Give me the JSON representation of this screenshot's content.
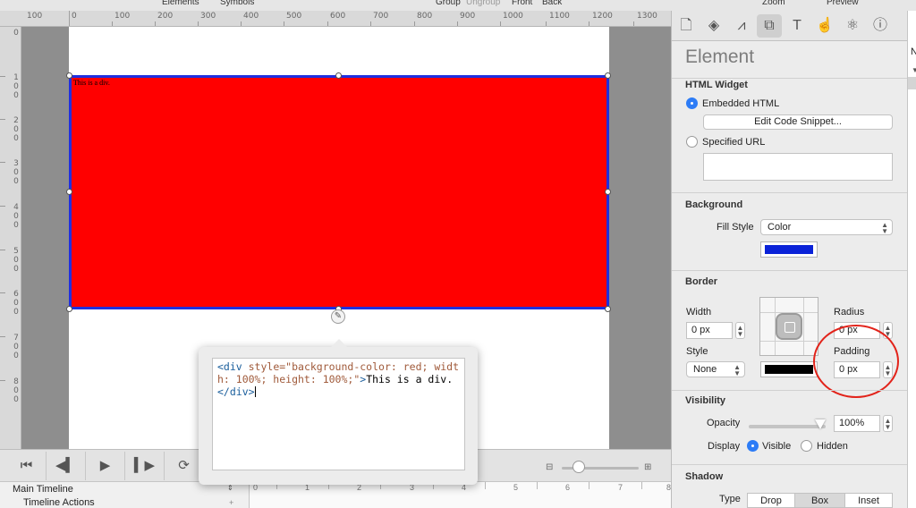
{
  "menu": {
    "elements": "Elements",
    "symbols": "Symbols",
    "group": "Group",
    "ungroup": "Ungroup",
    "front": "Front",
    "back": "Back",
    "zoom": "Zoom",
    "preview": "Preview"
  },
  "ruler": {
    "top_labels": [
      "100",
      "0",
      "100",
      "200",
      "300",
      "400",
      "500",
      "600",
      "700",
      "800",
      "900",
      "1000",
      "1100",
      "1200",
      "1300"
    ],
    "left_labels": [
      "0",
      "1 0 0",
      "2 0 0",
      "3 0 0",
      "4 0 0",
      "5 0 0",
      "6 0 0",
      "7 0 0",
      "8 0 0"
    ]
  },
  "canvas": {
    "div_text": "This is a div."
  },
  "code_popover": {
    "open_tag": "<div",
    "attr_name": " style=",
    "attr_value": "\"background-color: red; width: 100%; height: 100%;\"",
    "close_bracket": ">",
    "text": "This is a div.",
    "end_tag": "</div>"
  },
  "transport": {
    "first": "⏮",
    "prev": "◀▍",
    "play": "▶",
    "next": "▍▶",
    "loop": "⟳"
  },
  "timeline": {
    "main": "Main Timeline",
    "actions": "Timeline Actions",
    "tick_labels": [
      "0",
      "1",
      "2",
      "3",
      "4",
      "5",
      "6",
      "7",
      "8"
    ]
  },
  "inspector": {
    "title": "Element",
    "html_widget": {
      "title": "HTML Widget",
      "embedded": "Embedded HTML",
      "edit_button": "Edit Code Snippet...",
      "specified_url": "Specified URL",
      "url_value": ""
    },
    "background": {
      "title": "Background",
      "fill_style_label": "Fill Style",
      "fill_style_value": "Color",
      "color": "#0a22d8"
    },
    "border": {
      "title": "Border",
      "width_label": "Width",
      "width_value": "0 px",
      "radius_label": "Radius",
      "radius_value": "0 px",
      "style_label": "Style",
      "style_value": "None",
      "padding_label": "Padding",
      "padding_value": "0 px",
      "color": "#000000"
    },
    "visibility": {
      "title": "Visibility",
      "opacity_label": "Opacity",
      "opacity_value": "100%",
      "opacity_level": 1.0,
      "display_label": "Display",
      "visible": "Visible",
      "hidden": "Hidden"
    },
    "shadow": {
      "title": "Shadow",
      "type_label": "Type",
      "drop": "Drop",
      "box": "Box",
      "inset": "Inset"
    }
  },
  "right_strip": {
    "letter": "N"
  },
  "colors": {
    "div_fill": "#ff0000",
    "selection": "#1f2fe0",
    "accent": "#2d7cf6",
    "annotation": "#e2231a"
  }
}
